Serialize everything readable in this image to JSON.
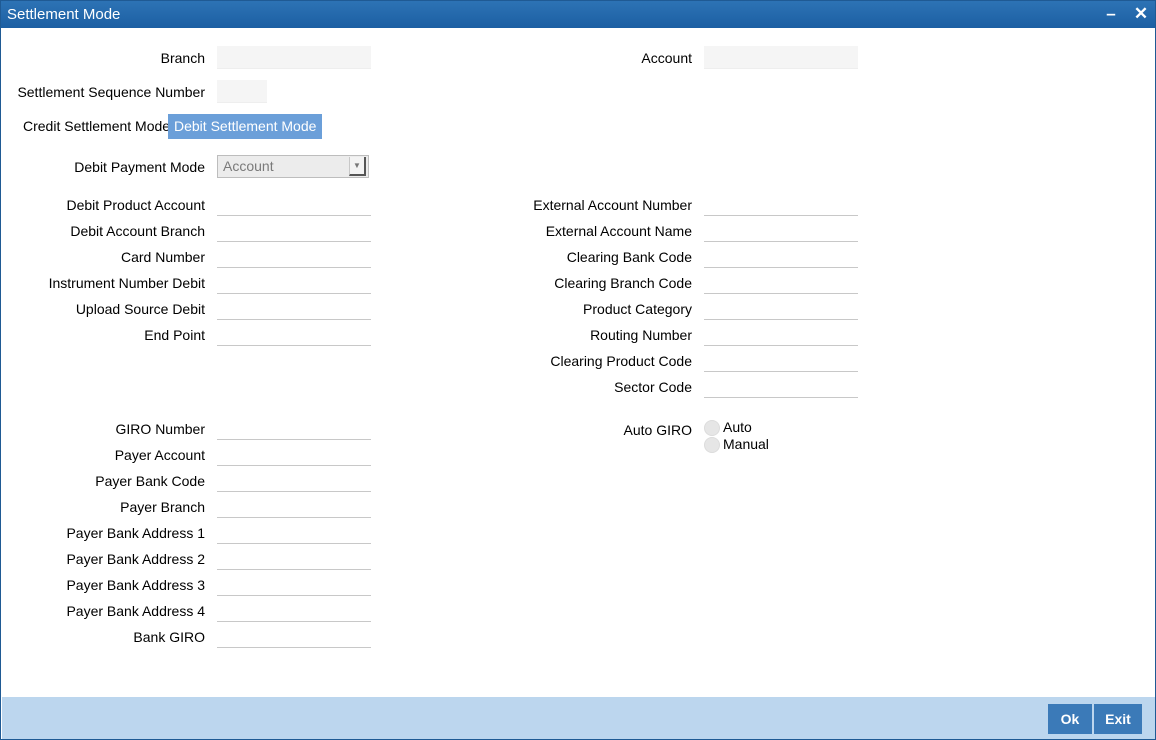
{
  "window": {
    "title": "Settlement Mode",
    "minimize_icon": "minimize-icon",
    "close_icon": "close-icon"
  },
  "header": {
    "branch_label": "Branch",
    "account_label": "Account",
    "seq_label": "Settlement Sequence Number"
  },
  "tabs": [
    {
      "label": "Credit Settlement Mode"
    },
    {
      "label": "Debit Settlement Mode"
    }
  ],
  "debit": {
    "payment_mode_label": "Debit Payment Mode",
    "payment_mode_value": "Account",
    "left": [
      "Debit Product Account",
      "Debit Account Branch",
      "Card Number",
      "Instrument Number Debit",
      "Upload Source Debit",
      "End Point"
    ],
    "right": [
      "External Account Number",
      "External Account Name",
      "Clearing Bank Code",
      "Clearing Branch Code",
      "Product Category",
      "Routing Number",
      "Clearing Product Code",
      "Sector Code"
    ]
  },
  "giro": {
    "left": [
      "GIRO Number",
      "Payer Account",
      "Payer Bank Code",
      "Payer Branch",
      "Payer Bank Address 1",
      "Payer Bank Address 2",
      "Payer Bank Address 3",
      "Payer Bank Address 4",
      "Bank GIRO"
    ],
    "auto_giro_label": "Auto GIRO",
    "auto_label": "Auto",
    "manual_label": "Manual"
  },
  "footer": {
    "ok_label": "Ok",
    "exit_label": "Exit"
  },
  "colors": {
    "titlebar": "#1c5fa3",
    "active_tab": "#6b9fd9",
    "footer": "#bcd6ee",
    "button": "#3b7ab8"
  }
}
